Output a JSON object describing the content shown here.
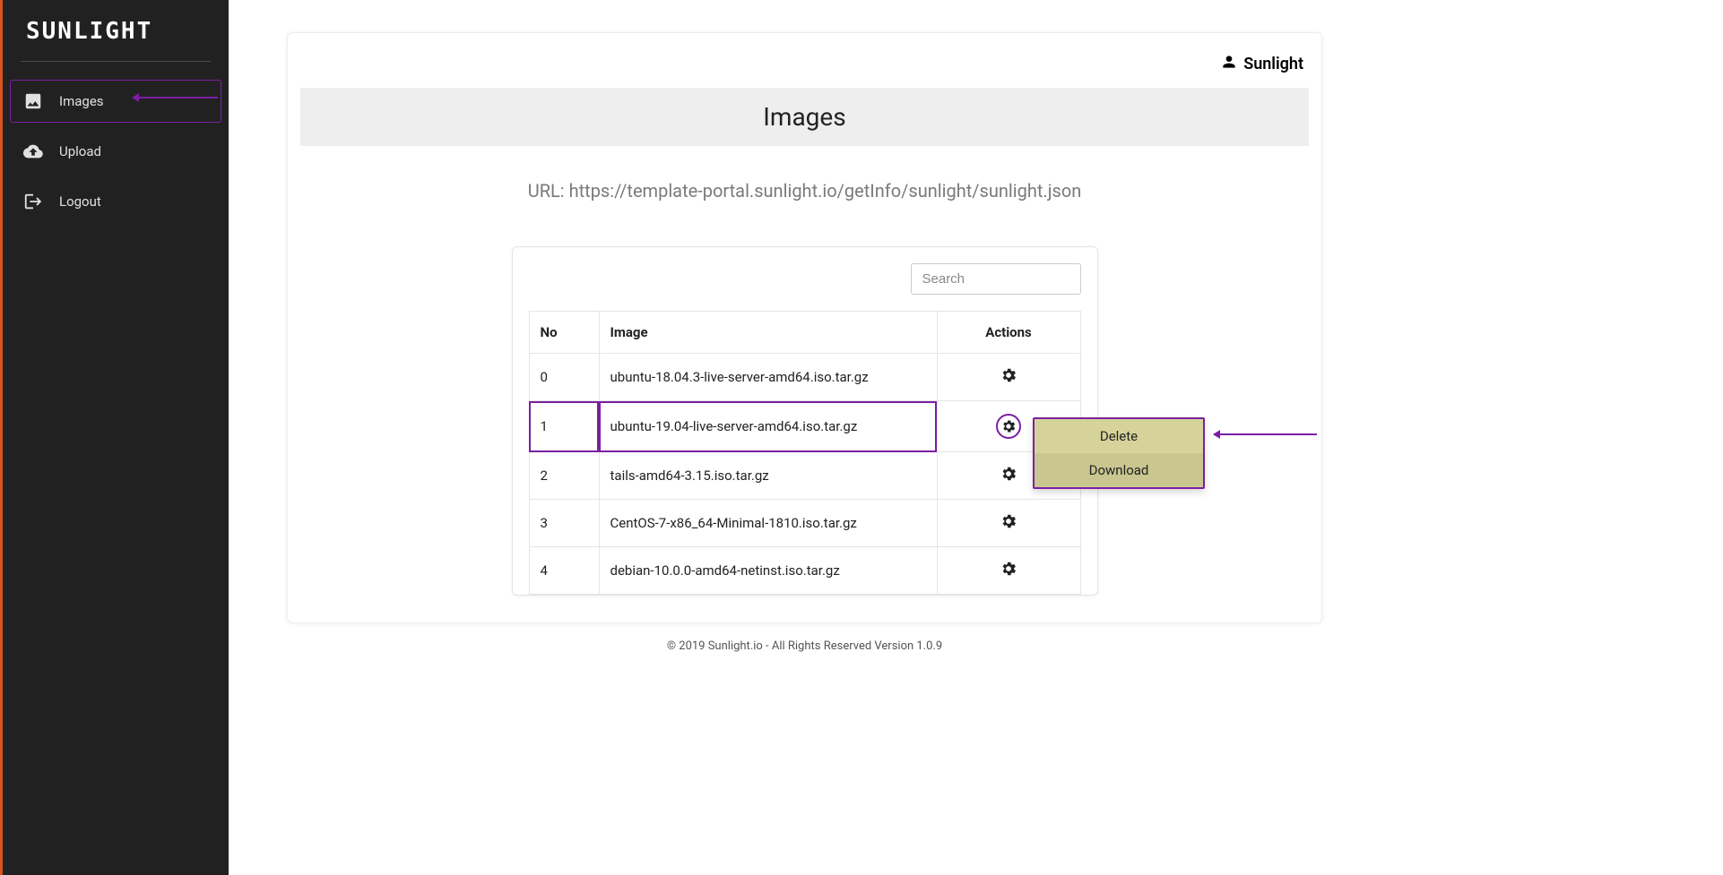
{
  "brand": "SUNLIGHT",
  "user": {
    "name": "Sunlight"
  },
  "sidebar": {
    "items": [
      {
        "label": "Images",
        "icon": "image-icon",
        "active": true
      },
      {
        "label": "Upload",
        "icon": "cloud-upload-icon",
        "active": false
      },
      {
        "label": "Logout",
        "icon": "logout-icon",
        "active": false
      }
    ]
  },
  "page": {
    "title": "Images",
    "url_label": "URL: https://template-portal.sunlight.io/getInfo/sunlight/sunlight.json"
  },
  "search": {
    "placeholder": "Search"
  },
  "table": {
    "columns": [
      "No",
      "Image",
      "Actions"
    ],
    "rows": [
      {
        "no": "0",
        "image": "ubuntu-18.04.3-live-server-amd64.iso.tar.gz",
        "menu_open": false
      },
      {
        "no": "1",
        "image": "ubuntu-19.04-live-server-amd64.iso.tar.gz",
        "menu_open": true
      },
      {
        "no": "2",
        "image": "tails-amd64-3.15.iso.tar.gz",
        "menu_open": false
      },
      {
        "no": "3",
        "image": "CentOS-7-x86_64-Minimal-1810.iso.tar.gz",
        "menu_open": false
      },
      {
        "no": "4",
        "image": "debian-10.0.0-amd64-netinst.iso.tar.gz",
        "menu_open": false
      }
    ]
  },
  "dropdown": {
    "items": [
      "Delete",
      "Download"
    ]
  },
  "footer": "© 2019 Sunlight.io - All Rights Reserved Version 1.0.9"
}
